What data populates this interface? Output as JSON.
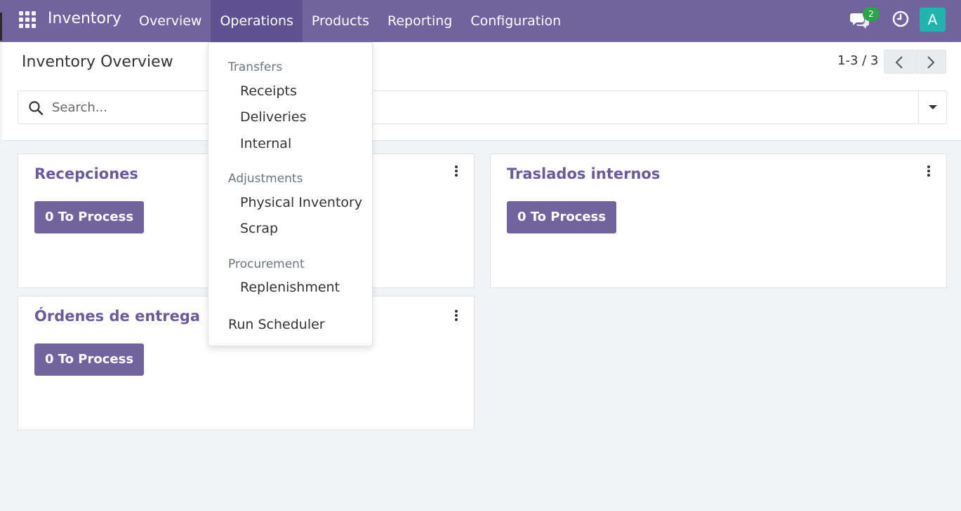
{
  "app": {
    "name": "Inventory"
  },
  "nav": {
    "items": [
      "Overview",
      "Operations",
      "Products",
      "Reporting",
      "Configuration"
    ]
  },
  "systray": {
    "chat_count": "2",
    "avatar_letter": "A"
  },
  "page": {
    "title": "Inventory Overview",
    "pager": "1-3 / 3"
  },
  "search": {
    "placeholder": "Search..."
  },
  "cards": [
    {
      "title": "Recepciones",
      "button": "0 To Process"
    },
    {
      "title": "Traslados internos",
      "button": "0 To Process"
    },
    {
      "title": "Órdenes de entrega",
      "button": "0 To Process"
    }
  ],
  "operations_menu": {
    "sections": [
      {
        "header": "Transfers",
        "items": [
          "Receipts",
          "Deliveries",
          "Internal"
        ]
      },
      {
        "header": "Adjustments",
        "items": [
          "Physical Inventory",
          "Scrap"
        ]
      },
      {
        "header": "Procurement",
        "items": [
          "Replenishment"
        ]
      }
    ],
    "run_scheduler": "Run Scheduler"
  },
  "colors": {
    "brand": "#71639e",
    "brand_active": "#5f5290",
    "badge": "#28a745",
    "avatar": "#1fb5ad"
  }
}
